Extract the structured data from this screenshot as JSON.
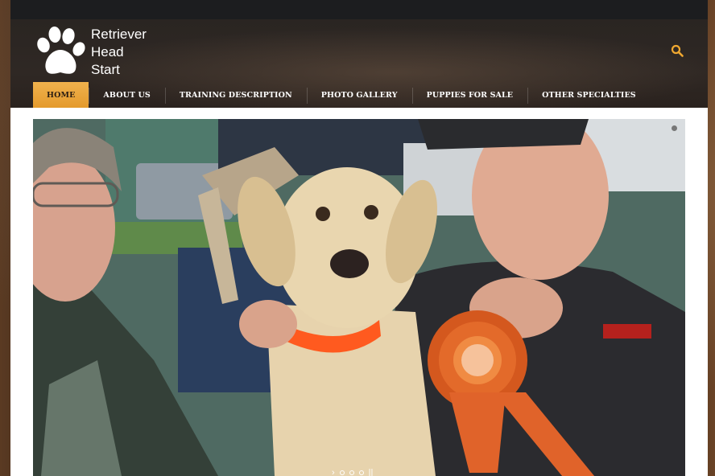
{
  "logo": {
    "line1": "Retriever",
    "line2": "Head",
    "line3": "Start"
  },
  "nav": {
    "items": [
      {
        "label": "HOME",
        "active": true
      },
      {
        "label": "ABOUT US"
      },
      {
        "label": "TRAINING DESCRIPTION"
      },
      {
        "label": "PHOTO GALLERY"
      },
      {
        "label": "PUPPIES FOR SALE"
      },
      {
        "label": "OTHER SPECIALTIES"
      }
    ]
  },
  "icons": {
    "search": "search-icon",
    "logo": "paw-print-icon"
  },
  "colors": {
    "accent": "#e9a43a",
    "search_icon": "#f0a830"
  },
  "slider": {
    "arrow": "›",
    "pause": "||",
    "dot_count": 3
  }
}
